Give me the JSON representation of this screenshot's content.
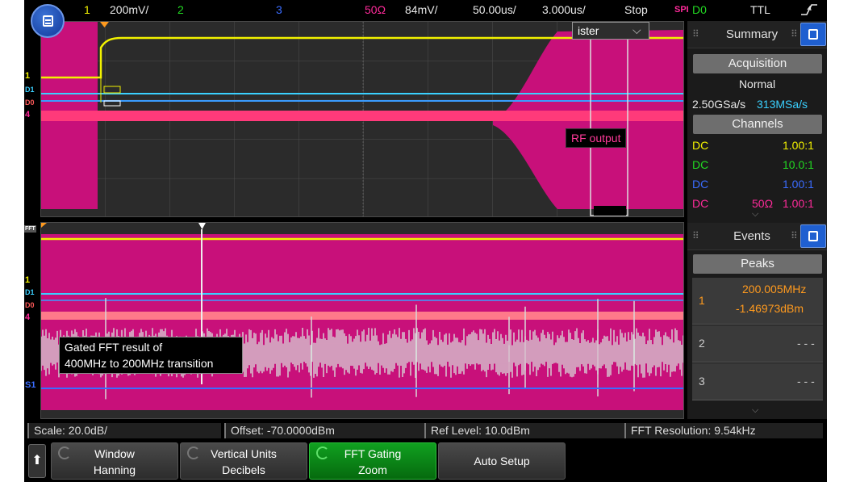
{
  "colors": {
    "ch1": "#f2f200",
    "ch2": "#22d822",
    "ch3": "#3a6cff",
    "ch4": "#ff2a9a",
    "accent_orange": "#ff9a1e",
    "magenta": "#c8107a"
  },
  "top_bar": {
    "ch1_num": "1",
    "ch1_scale": "200mV/",
    "ch2_num": "2",
    "ch3_num": "3",
    "ch4_impedance": "50Ω",
    "ch4_scale": "84mV/",
    "timebase": "50.00us/",
    "delay": "3.000us/",
    "run_state": "Stop",
    "trigger_type": "SPI",
    "trigger_source": "D0",
    "logic_level": "TTL",
    "trigger_slope_icon": "rising-edge-icon"
  },
  "main_panel": {
    "rf_label": "RF output",
    "lister_label": "ister"
  },
  "fft_panel": {
    "annotation_line1": "Gated FFT result of",
    "annotation_line2": "400MHz to 200MHz transition"
  },
  "summary": {
    "title": "Summary",
    "acquisition_label": "Acquisition",
    "acquisition_mode": "Normal",
    "sample_rate_analog": "2.50GSa/s",
    "sample_rate_digital": "313MSa/s",
    "channels_label": "Channels",
    "channels": [
      {
        "coupling": "DC",
        "impedance": "",
        "probe": "1.00:1"
      },
      {
        "coupling": "DC",
        "impedance": "",
        "probe": "10.0:1"
      },
      {
        "coupling": "DC",
        "impedance": "",
        "probe": "1.00:1"
      },
      {
        "coupling": "DC",
        "impedance": "50Ω",
        "probe": "1.00:1"
      }
    ]
  },
  "events": {
    "title": "Events",
    "peaks_label": "Peaks",
    "rows": [
      {
        "index": "1",
        "freq": "200.005MHz",
        "level": "-1.46973dBm"
      },
      {
        "index": "2",
        "value": "- - -"
      },
      {
        "index": "3",
        "value": "- - -"
      }
    ]
  },
  "info_bar": {
    "scale": "Scale: 20.0dB/",
    "offset": "Offset: -70.0000dBm",
    "ref_level": "Ref Level: 10.0dBm",
    "fft_resolution": "FFT Resolution: 9.54kHz"
  },
  "softkeys": {
    "window_l1": "Window",
    "window_l2": "Hanning",
    "vertical_l1": "Vertical Units",
    "vertical_l2": "Decibels",
    "gating_l1": "FFT Gating",
    "gating_l2": "Zoom",
    "auto_setup": "Auto Setup"
  },
  "gutter_labels": {
    "fft_marker": "FFT",
    "ch1": "1",
    "d0": "D0",
    "d1": "D1",
    "ch4": "4",
    "s1": "S1"
  }
}
